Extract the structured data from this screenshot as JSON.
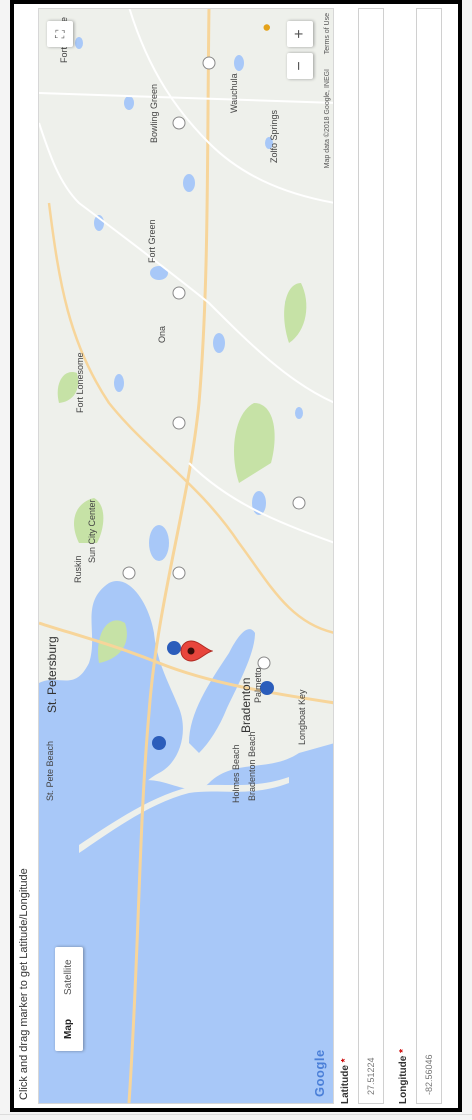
{
  "instruction": "Click and drag marker to get Latitude/Longitude",
  "map": {
    "type_control": {
      "map_label": "Map",
      "satellite_label": "Satellite",
      "selected": "Map"
    },
    "zoom_in_label": "+",
    "zoom_out_label": "−",
    "fullscreen_icon": "fullscreen-icon",
    "pegman_icon": "pegman-icon",
    "google_logo": "Google",
    "attribution": "Map data ©2018 Google, INEGI",
    "terms": "Terms of Use",
    "places": {
      "st_petersburg": "St. Petersburg",
      "bradenton": "Bradenton",
      "palmetto": "Palmetto",
      "holmes_beach": "Holmes Beach",
      "bradenton_beach": "Bradenton Beach",
      "longboat_key": "Longboat Key",
      "ruskin": "Ruskin",
      "sun_city_center": "Sun City Center",
      "fort_lonesome": "Fort Lonesome",
      "ona": "Ona",
      "fort_green": "Fort Green",
      "wauchula": "Wauchula",
      "bowling_green": "Bowling Green",
      "fort_meade": "Fort Meade",
      "zolfo_springs": "Zolfo Springs",
      "pass_a_grille": "St. Pete Beach"
    },
    "marker_icon": "map-pin-icon",
    "colors": {
      "water": "#a8c8f8",
      "land": "#eef0eb",
      "park": "#c6e2a6",
      "road": "#f7d59a",
      "marker": "#e8453c"
    }
  },
  "latitude": {
    "label": "Latitude",
    "required_mark": "*",
    "value": "27.51224"
  },
  "longitude": {
    "label": "Longitude",
    "required_mark": "*",
    "value": "-82.56046"
  }
}
